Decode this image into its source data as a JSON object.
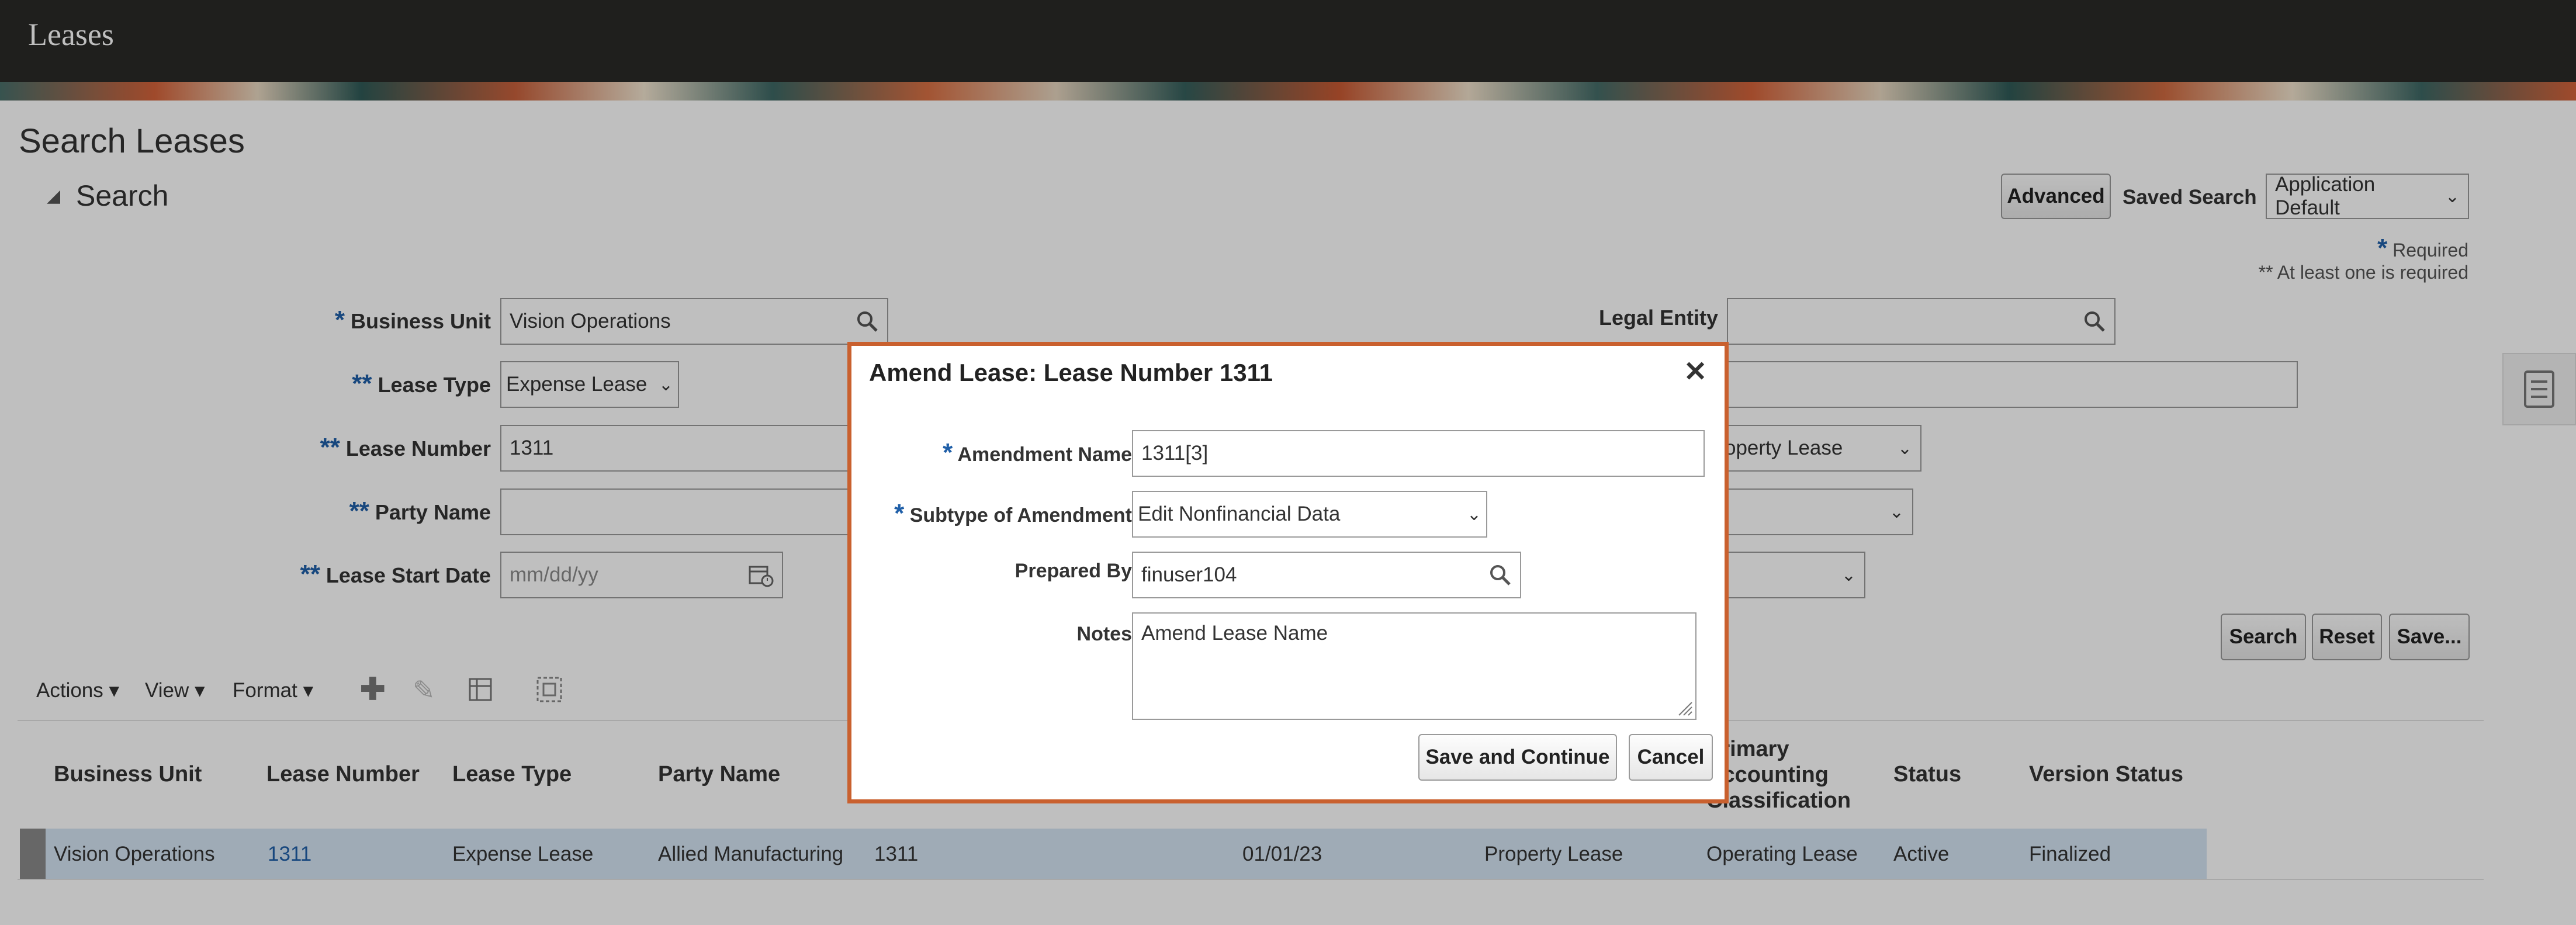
{
  "app": {
    "title": "Leases"
  },
  "page": {
    "title": "Search Leases"
  },
  "search": {
    "section_title": "Search",
    "advanced_label": "Advanced",
    "saved_search_label": "Saved Search",
    "saved_search_value": "Application Default",
    "required_note": "Required",
    "at_least_one_note": "** At least one is required",
    "fields": {
      "business_unit": {
        "label": "Business Unit",
        "value": "Vision Operations",
        "marker": "*"
      },
      "lease_type": {
        "label": "Lease Type",
        "value": "Expense Lease",
        "marker": "**"
      },
      "lease_number": {
        "label": "Lease Number",
        "value": "1311",
        "marker": "**"
      },
      "party_name": {
        "label": "Party Name",
        "value": "",
        "marker": "**"
      },
      "lease_start_date": {
        "label": "Lease Start Date",
        "placeholder": "mm/dd/yy",
        "marker": "**"
      },
      "legal_entity": {
        "label": "Legal Entity",
        "value": ""
      },
      "right_select_1": {
        "value": "Property Lease"
      }
    },
    "buttons": {
      "search": "Search",
      "reset": "Reset",
      "save": "Save..."
    }
  },
  "toolbar": {
    "actions": "Actions",
    "view": "View",
    "format": "Format"
  },
  "table": {
    "columns": [
      "Business Unit",
      "Lease Number",
      "Lease Type",
      "Party Name",
      "Primary Accounting Classification",
      "Status",
      "Version Status"
    ],
    "row": {
      "business_unit": "Vision Operations",
      "lease_number": "1311",
      "lease_type": "Expense Lease",
      "party_name": "Allied Manufacturing",
      "col5": "1311",
      "date": "01/01/23",
      "classification": "Property Lease",
      "accounting": "Operating Lease",
      "status": "Active",
      "version_status": "Finalized"
    }
  },
  "dialog": {
    "title": "Amend Lease: Lease Number 1311",
    "amendment_name_label": "Amendment Name",
    "amendment_name_value": "1311[3]",
    "subtype_label": "Subtype of Amendment",
    "subtype_value": "Edit Nonfinancial Data",
    "prepared_by_label": "Prepared By",
    "prepared_by_value": "finuser104",
    "notes_label": "Notes",
    "notes_value": "Amend Lease Name",
    "save_continue": "Save and Continue",
    "cancel": "Cancel"
  },
  "icons": [
    "search-icon",
    "calendar-icon",
    "plus-icon",
    "pencil-icon",
    "freeze-icon",
    "detach-icon",
    "close-icon",
    "task-panel-icon",
    "chevron-down-icon"
  ]
}
